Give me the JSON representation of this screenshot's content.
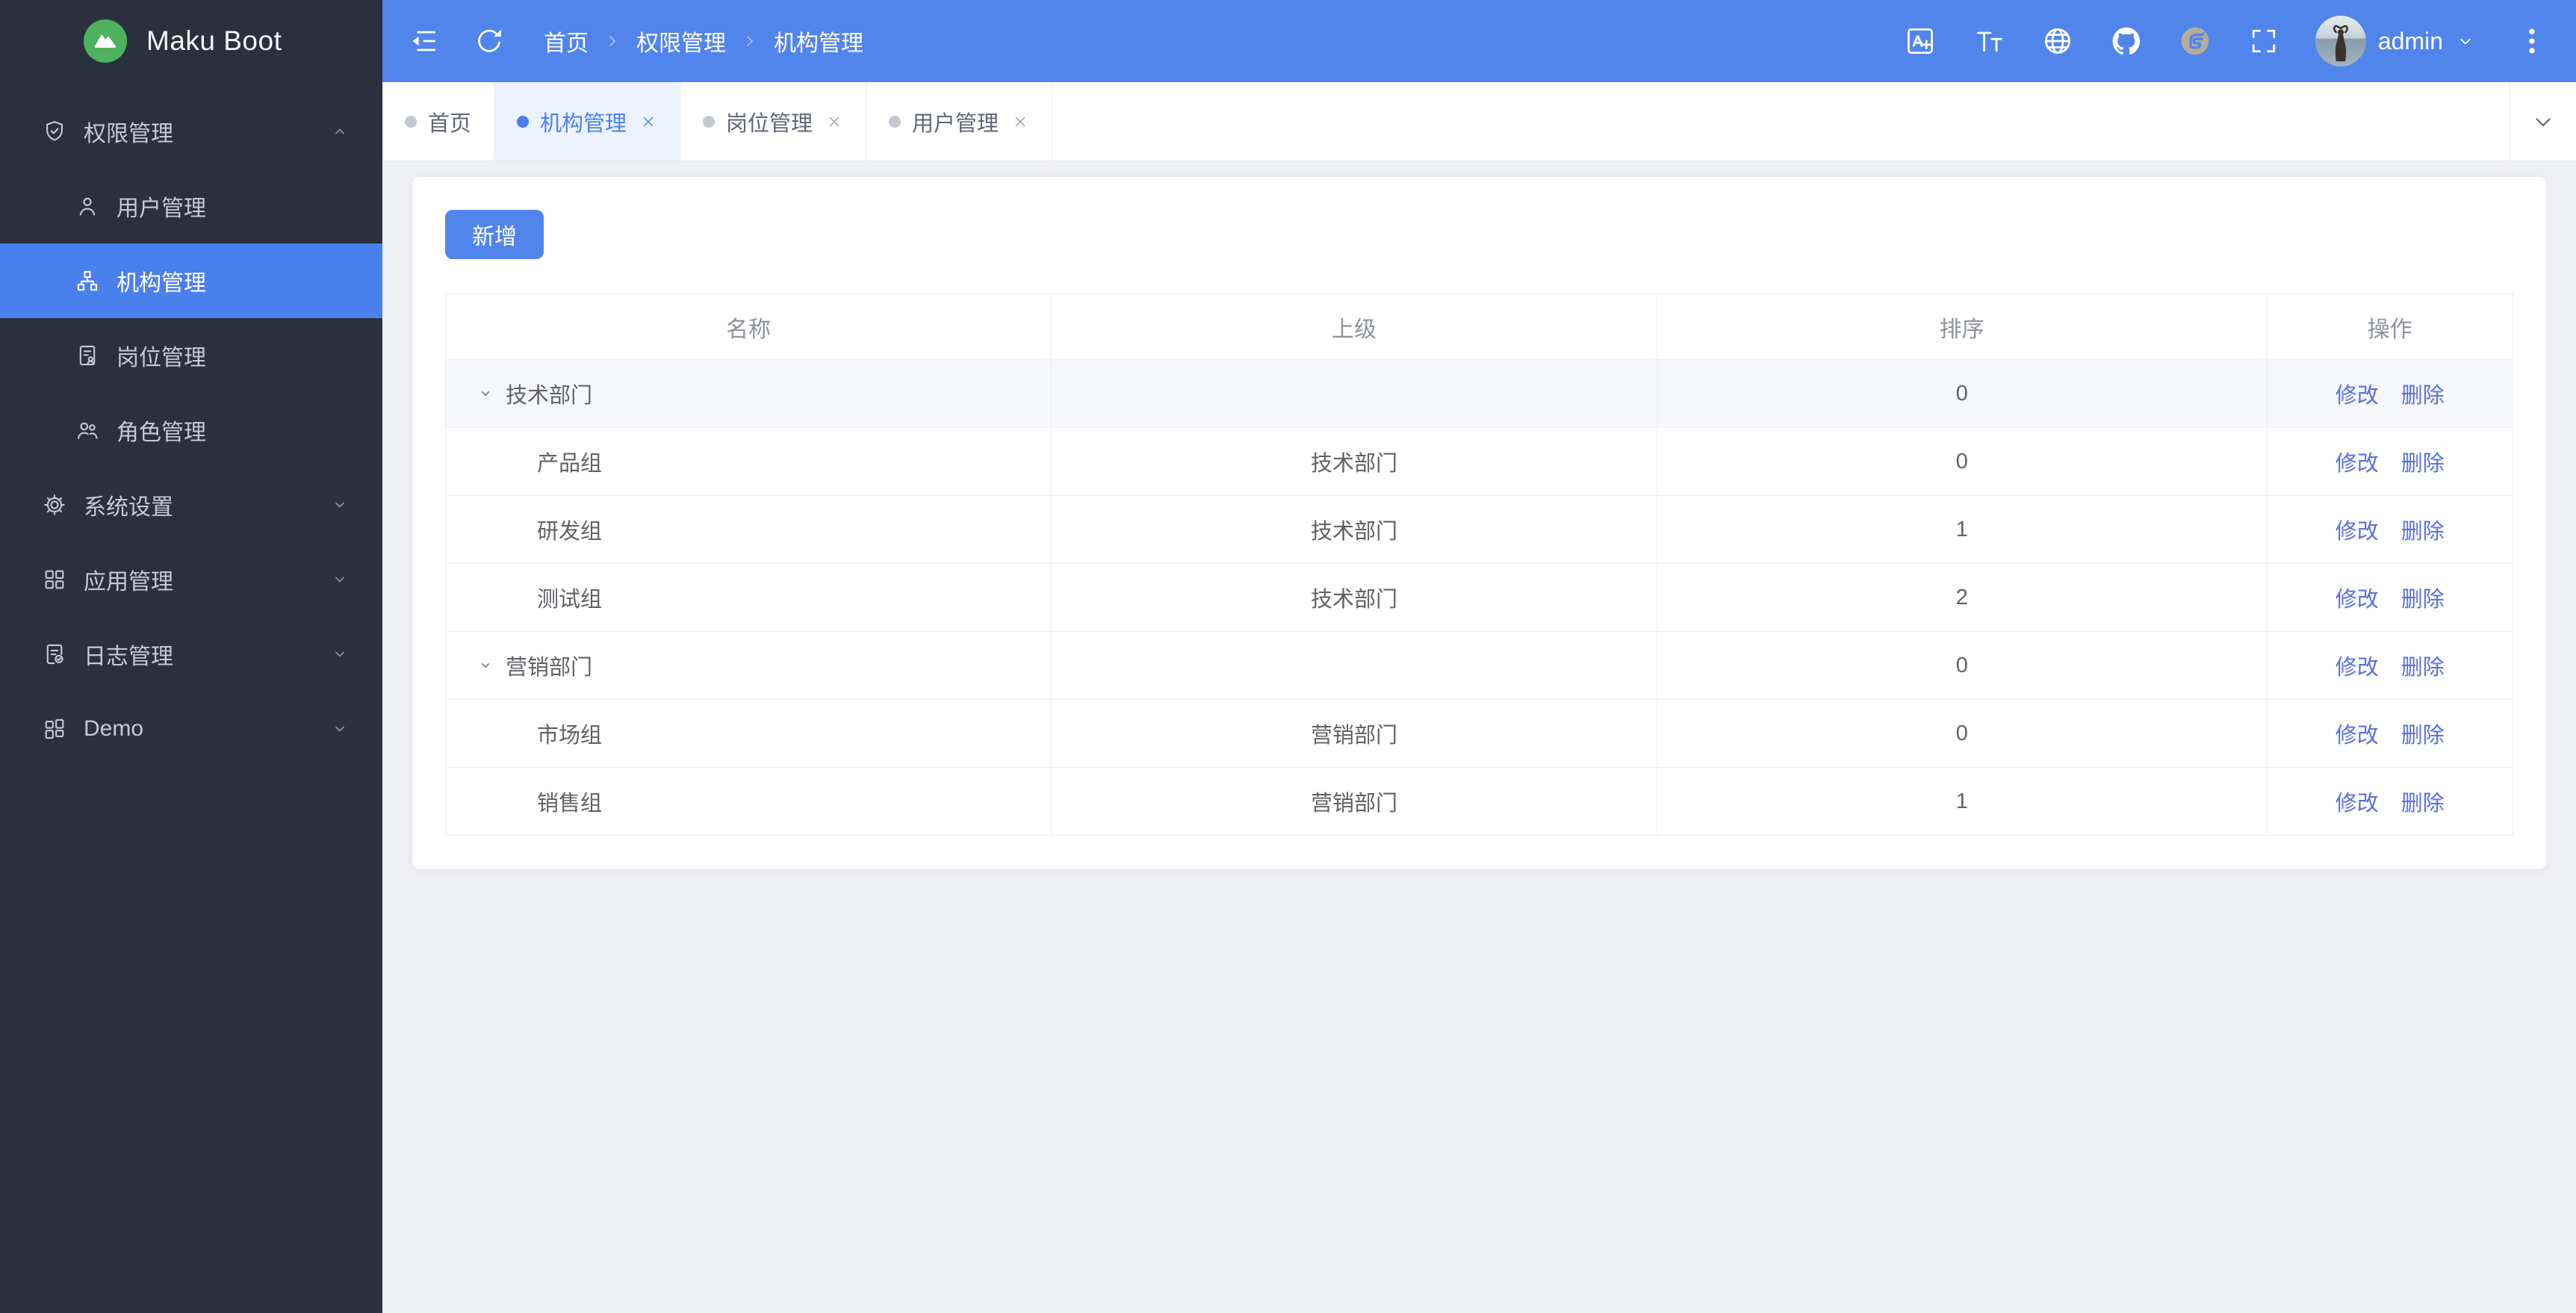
{
  "app": {
    "name": "Maku Boot"
  },
  "colors": {
    "primary": "#5285ec",
    "sidebar_bg": "#2a303c",
    "sidebar_active": "#4a80ee",
    "logo_green": "#4db15d",
    "link_blue": "#5a6ee0",
    "tab_active_bg": "#ecf3fe",
    "page_bg": "#eef0f4"
  },
  "sidebar": {
    "items": [
      {
        "label": "权限管理",
        "icon": "shield-check-icon",
        "expanded": true,
        "children": [
          {
            "label": "用户管理",
            "icon": "user-icon",
            "active": false
          },
          {
            "label": "机构管理",
            "icon": "org-chart-icon",
            "active": true
          },
          {
            "label": "岗位管理",
            "icon": "post-doc-icon",
            "active": false
          },
          {
            "label": "角色管理",
            "icon": "roles-icon",
            "active": false
          }
        ]
      },
      {
        "label": "系统设置",
        "icon": "gear-icon",
        "expanded": false
      },
      {
        "label": "应用管理",
        "icon": "apps-grid-icon",
        "expanded": false
      },
      {
        "label": "日志管理",
        "icon": "log-doc-icon",
        "expanded": false
      },
      {
        "label": "Demo",
        "icon": "demo-grid-icon",
        "expanded": false
      }
    ]
  },
  "header": {
    "breadcrumb": [
      "首页",
      "权限管理",
      "机构管理"
    ],
    "icons": [
      "fold-icon",
      "refresh-icon",
      "translate-icon",
      "font-size-icon",
      "globe-icon",
      "github-icon",
      "gitee-icon",
      "fullscreen-icon",
      "more-vertical-icon"
    ],
    "user": {
      "name": "admin"
    }
  },
  "tabs": {
    "items": [
      {
        "label": "首页",
        "closable": false,
        "active": false
      },
      {
        "label": "机构管理",
        "closable": true,
        "active": true
      },
      {
        "label": "岗位管理",
        "closable": true,
        "active": false
      },
      {
        "label": "用户管理",
        "closable": true,
        "active": false
      }
    ]
  },
  "main": {
    "add_button": "新增",
    "table": {
      "columns": [
        "名称",
        "上级",
        "排序",
        "操作"
      ],
      "actions": {
        "edit": "修改",
        "delete": "删除"
      },
      "rows": [
        {
          "name": "技术部门",
          "parent": "",
          "sort": "0",
          "level": 0,
          "expandable": true
        },
        {
          "name": "产品组",
          "parent": "技术部门",
          "sort": "0",
          "level": 1
        },
        {
          "name": "研发组",
          "parent": "技术部门",
          "sort": "1",
          "level": 1
        },
        {
          "name": "测试组",
          "parent": "技术部门",
          "sort": "2",
          "level": 1
        },
        {
          "name": "营销部门",
          "parent": "",
          "sort": "0",
          "level": 0,
          "expandable": true
        },
        {
          "name": "市场组",
          "parent": "营销部门",
          "sort": "0",
          "level": 1
        },
        {
          "name": "销售组",
          "parent": "营销部门",
          "sort": "1",
          "level": 1
        }
      ]
    }
  }
}
